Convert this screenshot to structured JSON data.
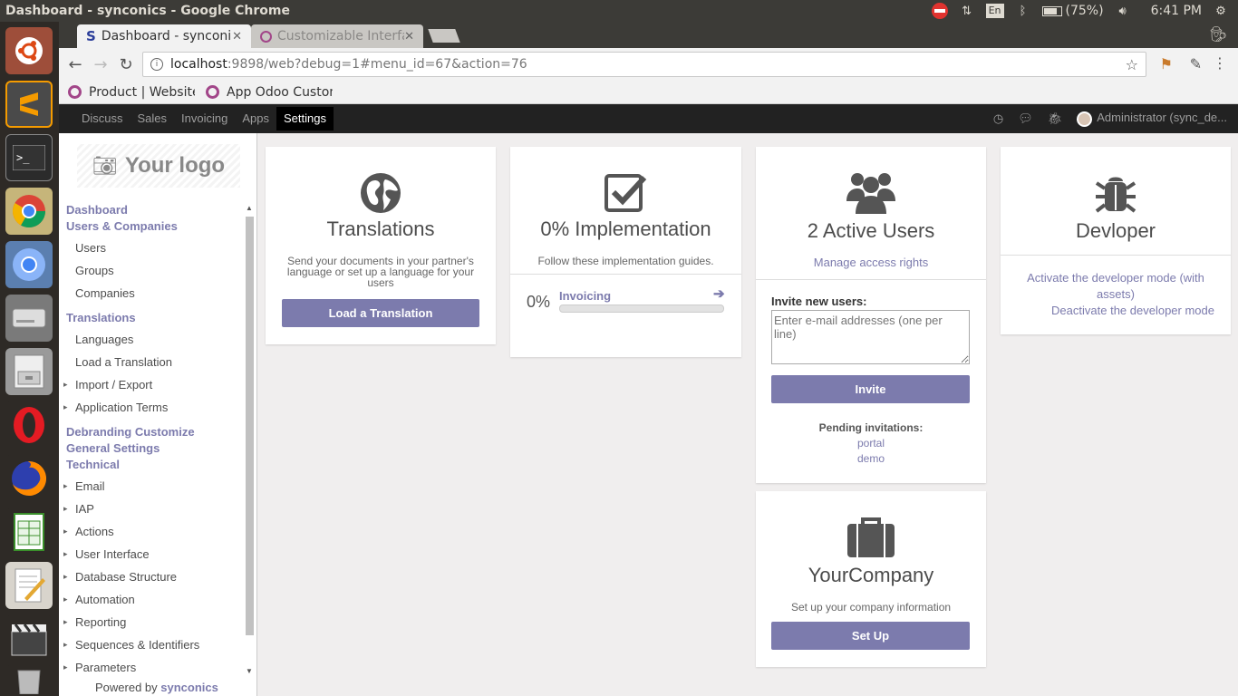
{
  "os": {
    "window_title": "Dashboard - synconics - Google Chrome",
    "battery": "(75%)",
    "time": "6:41 PM",
    "keyboard_layout": "En"
  },
  "browser": {
    "tabs": [
      {
        "label": "Dashboard - synconics",
        "favicon": "s-favicon-icon"
      },
      {
        "label": "Customizable Interface",
        "favicon": "odoo-icon"
      }
    ],
    "url_host": "localhost",
    "url_path": ":9898/web?debug=1#menu_id=67&action=76",
    "bookmarks": [
      {
        "label": "Product | Website"
      },
      {
        "label": "App Odoo Custom"
      }
    ]
  },
  "navbar": {
    "menus": [
      "Discuss",
      "Sales",
      "Invoicing",
      "Apps",
      "Settings"
    ],
    "active": "Settings",
    "user": "Administrator (sync_de..."
  },
  "sidebar": {
    "logo_text": "Your logo",
    "groups": [
      {
        "type": "head",
        "label": "Dashboard"
      },
      {
        "type": "head",
        "label": "Users & Companies"
      },
      {
        "type": "item",
        "label": "Users"
      },
      {
        "type": "item",
        "label": "Groups"
      },
      {
        "type": "item",
        "label": "Companies"
      },
      {
        "type": "head",
        "label": "Translations"
      },
      {
        "type": "item",
        "label": "Languages"
      },
      {
        "type": "item",
        "label": "Load a Translation"
      },
      {
        "type": "caret",
        "label": "Import / Export"
      },
      {
        "type": "caret",
        "label": "Application Terms"
      },
      {
        "type": "head",
        "label": "Debranding Customize"
      },
      {
        "type": "head",
        "label": "General Settings"
      },
      {
        "type": "head",
        "label": "Technical"
      },
      {
        "type": "caret",
        "label": "Email"
      },
      {
        "type": "caret",
        "label": "IAP"
      },
      {
        "type": "caret",
        "label": "Actions"
      },
      {
        "type": "caret",
        "label": "User Interface"
      },
      {
        "type": "caret",
        "label": "Database Structure"
      },
      {
        "type": "caret",
        "label": "Automation"
      },
      {
        "type": "caret",
        "label": "Reporting"
      },
      {
        "type": "caret",
        "label": "Sequences & Identifiers"
      },
      {
        "type": "caret",
        "label": "Parameters"
      }
    ],
    "powered_prefix": "Powered by",
    "powered_brand": "synconics"
  },
  "dashboard": {
    "translations": {
      "title": "Translations",
      "description": "Send your documents in your partner's language or set up a language for your users",
      "button": "Load a Translation"
    },
    "implementation": {
      "title": "0% Implementation",
      "description": "Follow these implementation guides.",
      "percent_label": "0%",
      "guide": "Invoicing",
      "progress": 0
    },
    "users": {
      "title": "2 Active Users",
      "manage_link": "Manage access rights",
      "invite_label": "Invite new users:",
      "invite_placeholder": "Enter e-mail addresses (one per line)",
      "invite_button": "Invite",
      "pending_label": "Pending invitations:",
      "pending": [
        "portal",
        "demo"
      ]
    },
    "developer": {
      "title": "Devloper",
      "activate_link": "Activate the developer mode (with assets)",
      "deactivate_link": "Deactivate the developer mode"
    },
    "company": {
      "title": "YourCompany",
      "description": "Set up your company information",
      "button": "Set Up"
    }
  }
}
